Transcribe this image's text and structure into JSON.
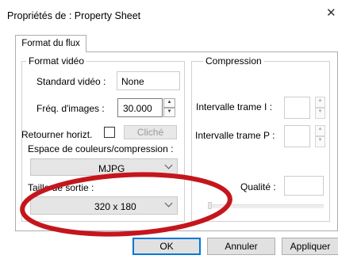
{
  "window": {
    "title": "Propriétés de : Property Sheet",
    "close_glyph": "✕"
  },
  "tabs": [
    {
      "label": "Format du flux",
      "active": true
    }
  ],
  "video_format": {
    "legend": "Format vidéo",
    "standard_label": "Standard vidéo :",
    "standard_value": "None",
    "framerate_label": "Fréq. d'images :",
    "framerate_value": "30.000",
    "flip_label": "Retourner horizt.",
    "flip_checked": false,
    "snapshot_label": "Cliché",
    "colorspace_label": "Espace de couleurs/compression :",
    "colorspace_value": "MJPG",
    "output_size_label": "Taille de sortie :",
    "output_size_value": "320 x 180"
  },
  "compression": {
    "legend": "Compression",
    "i_frame_label": "Intervalle trame I :",
    "i_frame_value": "",
    "p_frame_label": "Intervalle trame P :",
    "p_frame_value": "",
    "quality_label": "Qualité :",
    "quality_value": ""
  },
  "buttons": {
    "ok": "OK",
    "cancel": "Annuler",
    "apply": "Appliquer"
  },
  "colors": {
    "annotation_ellipse": "#c4161c",
    "disabled_text": "#6d6d6d"
  }
}
